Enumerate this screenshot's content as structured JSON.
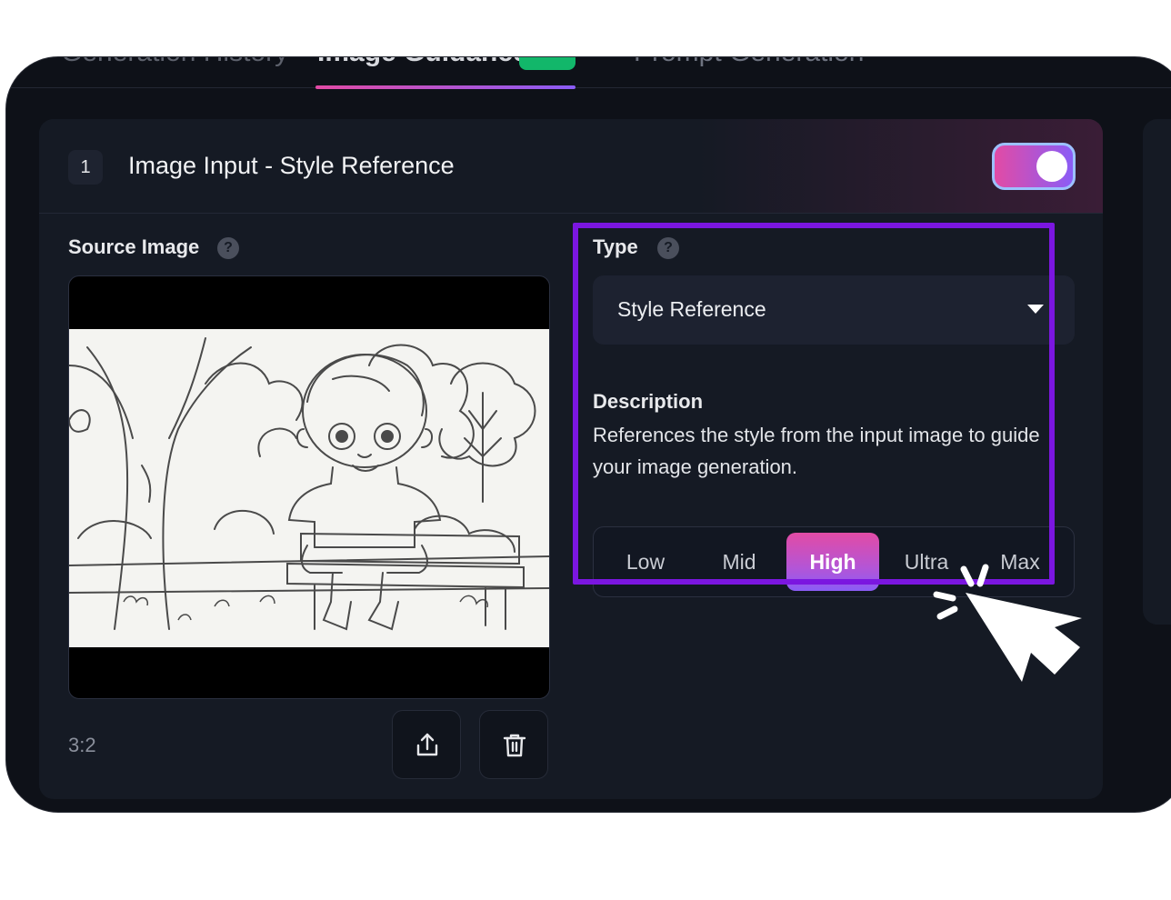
{
  "tabs": [
    {
      "label": "Generation History"
    },
    {
      "label": "Image Guidance"
    },
    {
      "label": "Prompt Generation"
    }
  ],
  "panel": {
    "step_number": "1",
    "title": "Image Input - Style Reference",
    "toggle_on": true
  },
  "source": {
    "label": "Source Image",
    "ratio": "3:2"
  },
  "type": {
    "label": "Type",
    "selected": "Style Reference"
  },
  "description": {
    "title": "Description",
    "text": "References the style from the input image to guide your image generation."
  },
  "strength": {
    "options": [
      "Low",
      "Mid",
      "High",
      "Ultra",
      "Max"
    ],
    "selected": "High"
  },
  "colors": {
    "accent_gradient_start": "#e24ba5",
    "accent_gradient_end": "#8a5cf6",
    "highlight_box": "#7b16e0",
    "badge_green": "#12b76a"
  },
  "icons": [
    "help-icon",
    "upload-icon",
    "trash-icon",
    "dropdown-caret-icon",
    "pointer-cursor-icon"
  ]
}
